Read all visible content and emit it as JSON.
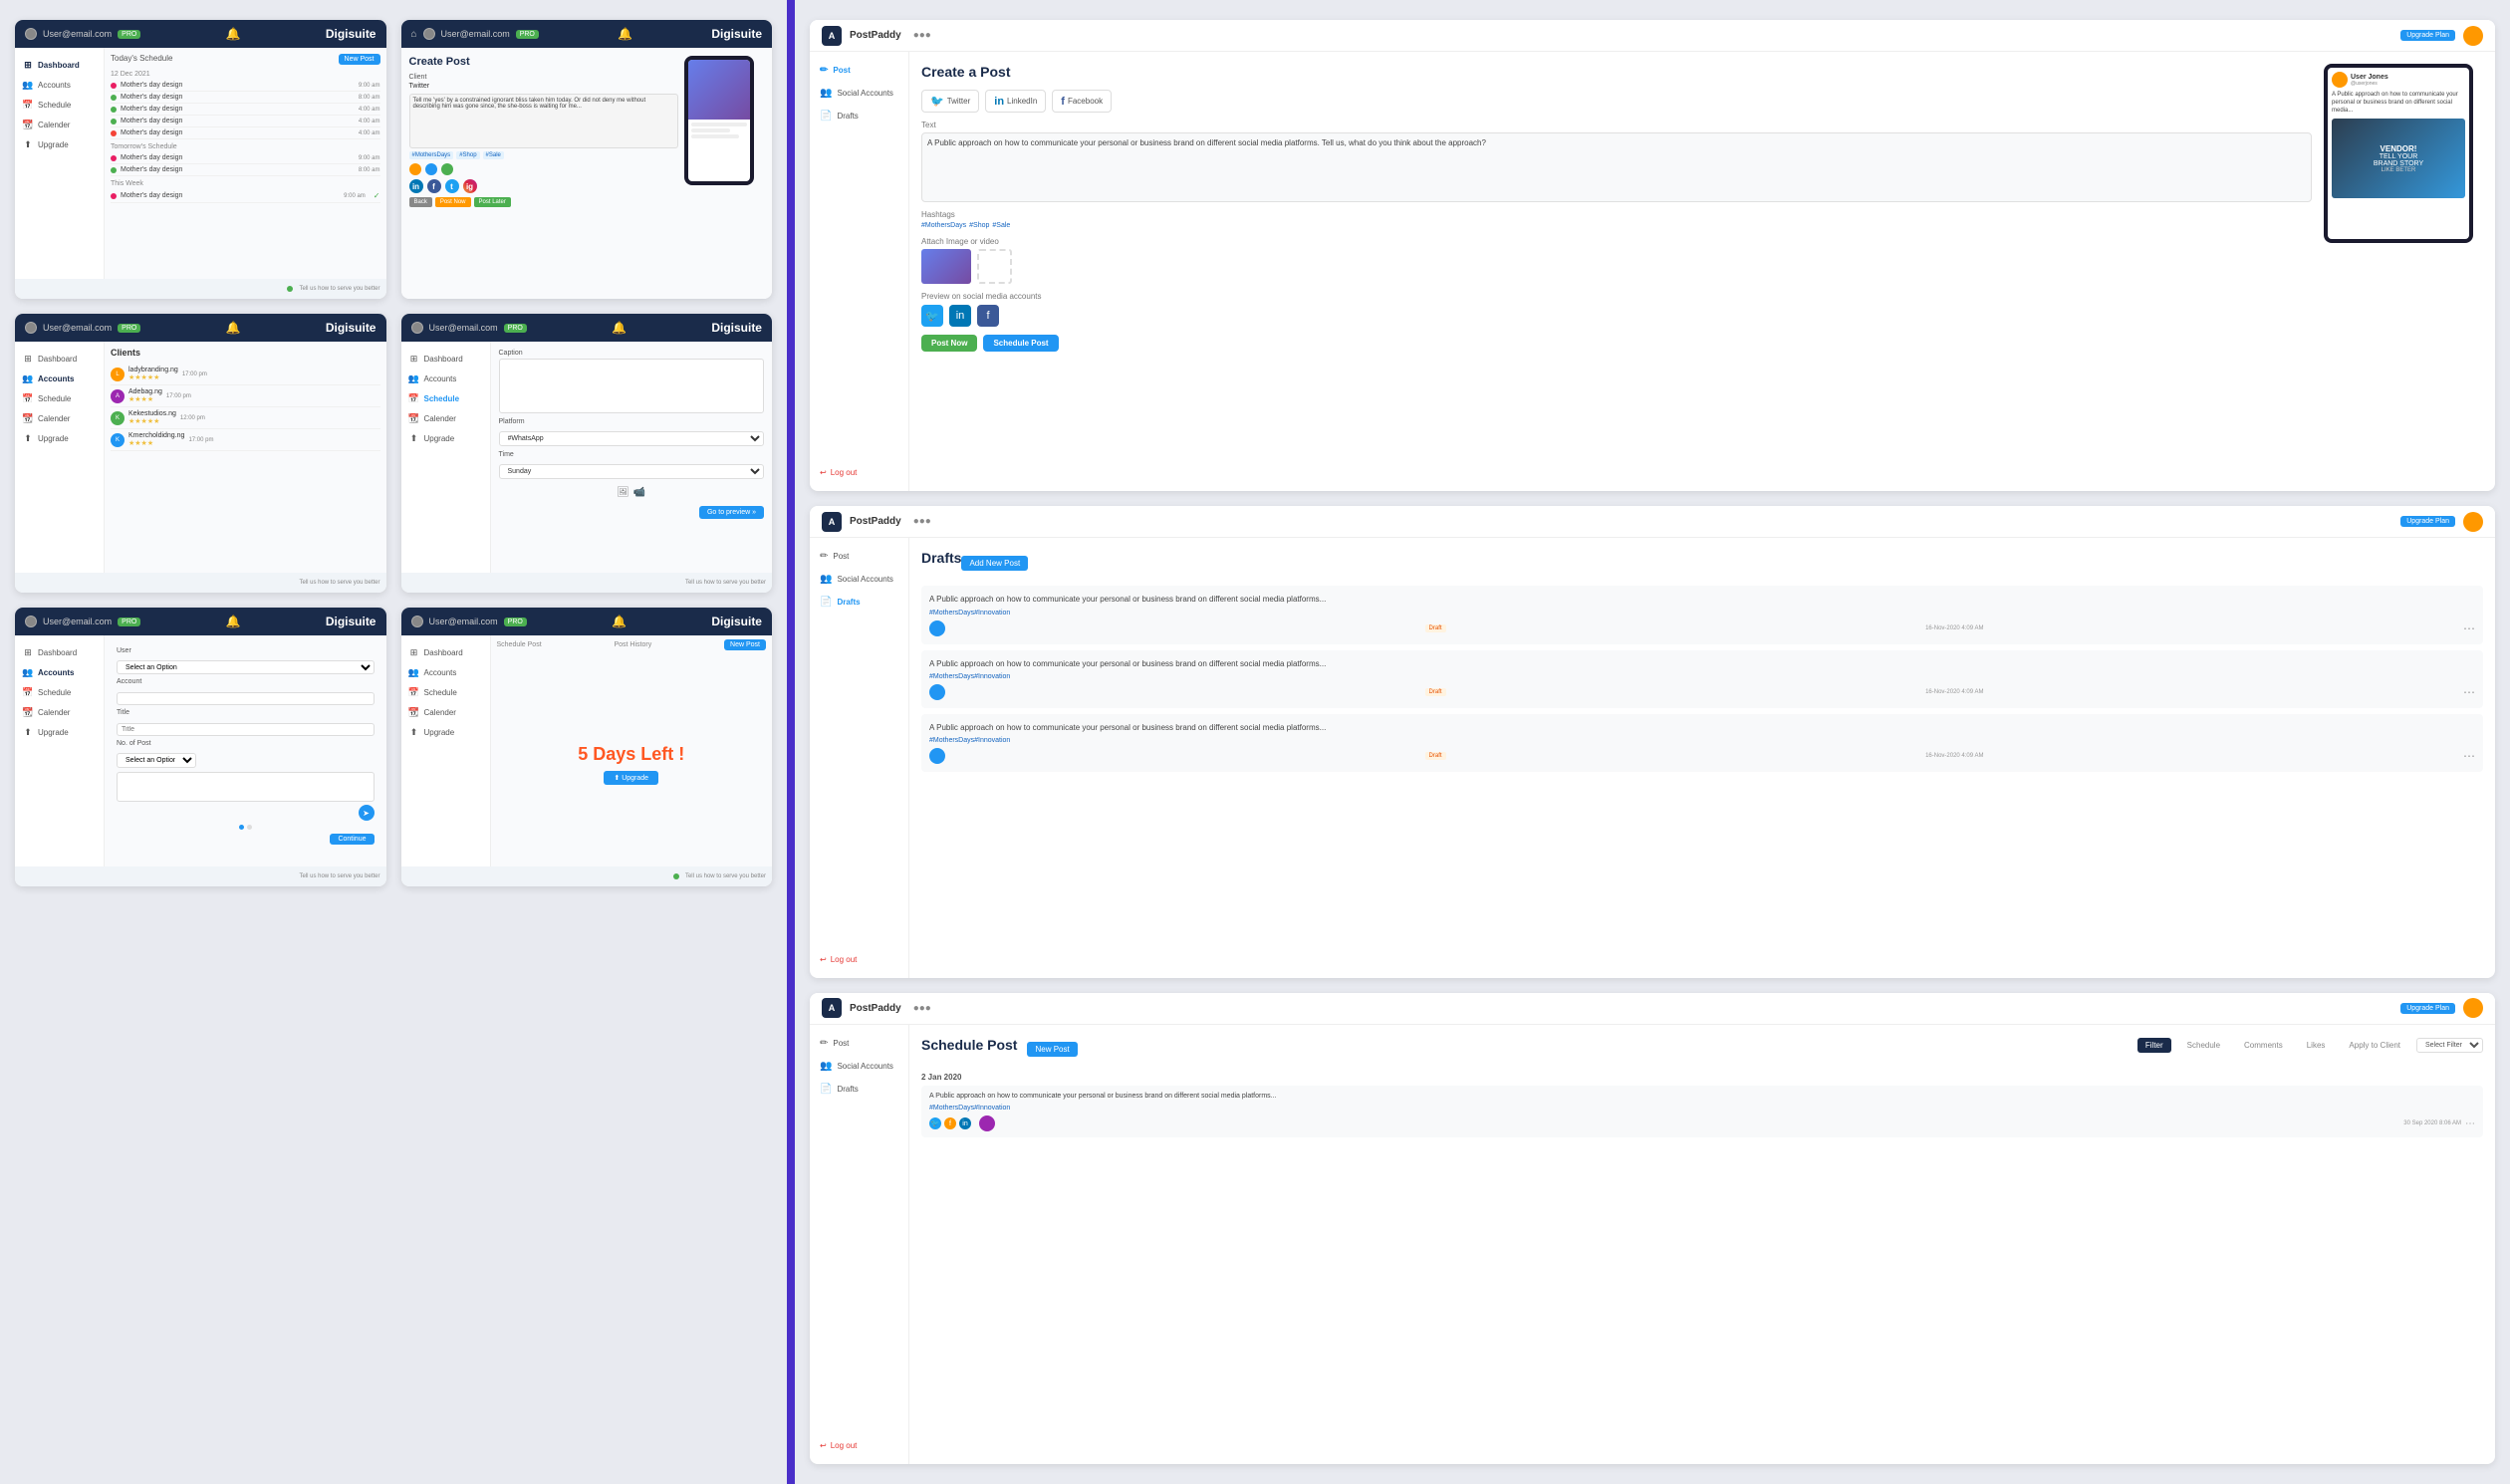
{
  "app": {
    "title": "Digisuite",
    "brand_right": "PostPaddy",
    "divider_color": "#4a2fc9"
  },
  "screens": {
    "screen1": {
      "nav": {
        "email": "User@email.com",
        "badge": "PRO",
        "title": "Digisuite"
      },
      "sidebar": [
        {
          "icon": "⊞",
          "label": "Dashboard",
          "active": true
        },
        {
          "icon": "👥",
          "label": "Accounts"
        },
        {
          "icon": "📅",
          "label": "Schedule"
        },
        {
          "icon": "📆",
          "label": "Calender"
        },
        {
          "icon": "⬆",
          "label": "Upgrade"
        }
      ],
      "content": {
        "title": "Today's Schedule",
        "date": "12 Dec 2021",
        "new_post_btn": "New Post",
        "tomorrow_title": "Tomorrow's Schedule",
        "week_title": "This Week",
        "items": [
          {
            "color": "#e91e63",
            "text": "Mother's day design",
            "time": "9:00 am"
          },
          {
            "color": "#4caf50",
            "text": "Mother's day design",
            "time": "8:00 am"
          },
          {
            "color": "#4caf50",
            "text": "Mother's day design",
            "time": "4:00 am"
          },
          {
            "color": "#4caf50",
            "text": "Mother's day design",
            "time": "4:00 am"
          },
          {
            "color": "#f44336",
            "text": "Mother's day design",
            "time": "4:00 am"
          }
        ],
        "tomorrow_items": [
          {
            "color": "#e91e63",
            "text": "Mother's day design",
            "time": "9:00 am"
          },
          {
            "color": "#4caf50",
            "text": "Mother's day design",
            "time": "8:00 am"
          }
        ],
        "week_items": [
          {
            "color": "#e91e63",
            "text": "Mother's day design",
            "time": "9:00 am"
          }
        ]
      }
    },
    "screen2": {
      "nav": {
        "email": "User@email.com",
        "badge": "PRO",
        "title": "Digisuite"
      },
      "content": {
        "title": "Create Post",
        "client_label": "Client",
        "client_value": "Twitter",
        "caption_placeholder": "Tell me 'yes' by a constrained ignorant bliss taken him today. Or did not deny me without describing him was gone since, the she-boss is waiting for me...",
        "hashtags": [
          "#MothersDays",
          "#Shop",
          "#Sale"
        ],
        "social_platforms": [
          "in",
          "f",
          "tw",
          "ig"
        ],
        "buttons": {
          "back": "Back",
          "post_now": "Post Now",
          "post_later": "Post Later"
        }
      }
    },
    "screen3": {
      "nav": {
        "email": "User@email.com",
        "badge": "PRO",
        "title": "Digisuite"
      },
      "sidebar": [
        {
          "icon": "⊞",
          "label": "Dashboard"
        },
        {
          "icon": "👥",
          "label": "Accounts",
          "active": true
        },
        {
          "icon": "📅",
          "label": "Schedule"
        },
        {
          "icon": "📆",
          "label": "Calender"
        },
        {
          "icon": "⬆",
          "label": "Upgrade"
        }
      ],
      "content": {
        "title": "Clients",
        "clients": [
          {
            "name": "ladybranding.ng",
            "time": "17:00 pm",
            "stars": "★★★★★"
          },
          {
            "name": "Adebag.ng",
            "time": "17:00 pm",
            "stars": "★★★★"
          },
          {
            "name": "Kekestudios.ng",
            "time": "12:00 pm",
            "stars": "★★★★★"
          },
          {
            "name": "Kmercholdidng.ng",
            "time": "17:00 pm",
            "stars": "★★★★"
          }
        ]
      }
    },
    "screen4": {
      "nav": {
        "email": "User@email.com",
        "badge": "PRO",
        "title": "Digisuite"
      },
      "sidebar": [
        {
          "icon": "⊞",
          "label": "Dashboard"
        },
        {
          "icon": "👥",
          "label": "Accounts"
        },
        {
          "icon": "📅",
          "label": "Schedule",
          "active_blue": true
        },
        {
          "icon": "📆",
          "label": "Calender"
        },
        {
          "icon": "⬆",
          "label": "Upgrade"
        }
      ],
      "content": {
        "caption_placeholder": "Caption",
        "platform_label": "Platform",
        "time_label": "Time",
        "platform_options": [
          "#WhatsApp"
        ],
        "time_options": [
          "Sunday"
        ],
        "preview_btn": "Go to preview »"
      }
    },
    "screen5": {
      "nav": {
        "email": "User@email.com",
        "badge": "PRO",
        "title": "Digisuite"
      },
      "sidebar": [
        {
          "icon": "⊞",
          "label": "Dashboard"
        },
        {
          "icon": "👥",
          "label": "Accounts",
          "active": true
        },
        {
          "icon": "📅",
          "label": "Schedule"
        },
        {
          "icon": "📆",
          "label": "Calender"
        },
        {
          "icon": "⬆",
          "label": "Upgrade"
        }
      ],
      "content": {
        "user_label": "User",
        "account_label": "Account",
        "title_label": "Title",
        "bio_label": "No. of Post",
        "continue_btn": "Continue",
        "send_icon": "➤"
      }
    },
    "screen6": {
      "nav": {
        "email": "User@email.com",
        "badge": "PRO",
        "title": "Digisuite"
      },
      "sidebar": [
        {
          "icon": "⊞",
          "label": "Dashboard"
        },
        {
          "icon": "👥",
          "label": "Accounts"
        },
        {
          "icon": "📅",
          "label": "Schedule"
        },
        {
          "icon": "📆",
          "label": "Calender"
        },
        {
          "icon": "⬆",
          "label": "Upgrade"
        }
      ],
      "content": {
        "days_left": "5 Days Left !",
        "upgrade_btn": "⬆ Upgrade"
      }
    }
  },
  "postpaddy": {
    "brand": "PostPaddy",
    "upgrade_btn": "Upgrade Plan",
    "screen1": {
      "title": "Create a Post",
      "platforms": [
        "Twitter",
        "LinkedIn",
        "Facebook"
      ],
      "sidebar": [
        "Post",
        "Social Accounts",
        "Drafts"
      ],
      "caption_text": "A Public approach on how to communicate your personal or business brand on different social media platforms. Tell us, what do you think about the approach?",
      "hashtags": [
        "#MothersDays",
        "#Shop",
        "#Sale"
      ],
      "attach_image_label": "Attach Image or video",
      "social_preview_label": "Preview on social media accounts",
      "btn_post_now": "Post Now",
      "btn_schedule": "Schedule Post",
      "logout": "Log out"
    },
    "screen2": {
      "title": "Drafts",
      "new_post_btn": "Add New Post",
      "items": [
        {
          "text": "A Public approach on how to communicate your personal or business brand on different social media platforms...",
          "hashtag": "#MothersDays#Innovation",
          "badge": "Draft",
          "date": "16-Nov-2020 4:09 AM"
        },
        {
          "text": "A Public approach on how to communicate your personal or business brand on different social media platforms...",
          "hashtag": "#MothersDays#Innovation",
          "badge": "Draft",
          "date": "16-Nov-2020 4:09 AM"
        },
        {
          "text": "A Public approach on how to communicate your personal or business brand on different social media platforms...",
          "hashtag": "#MothersDays#Innovation",
          "badge": "Draft",
          "date": "16-Nov-2020 4:09 AM"
        }
      ],
      "sidebar": [
        "Post",
        "Social Accounts",
        "Drafts"
      ],
      "logout": "Log out"
    },
    "screen3": {
      "title": "Schedule Post",
      "tabs": [
        "Filter",
        "Schedule",
        "Comments",
        "Likes",
        "Apply to Client"
      ],
      "active_tab": "Filter",
      "new_post_btn": "New Post",
      "month_header": "2 Jan 2020",
      "sidebar": [
        "Post",
        "Social Accounts",
        "Drafts"
      ],
      "post": {
        "text": "A Public approach on how to communicate your personal or business brand on different social media platforms...",
        "hashtag": "#MothersDays#Innovation",
        "date": "30 Sep 2020 8:06 AM",
        "social_platforms": [
          "twitter",
          "facebook",
          "linkedin"
        ]
      },
      "logout": "Log out"
    }
  }
}
